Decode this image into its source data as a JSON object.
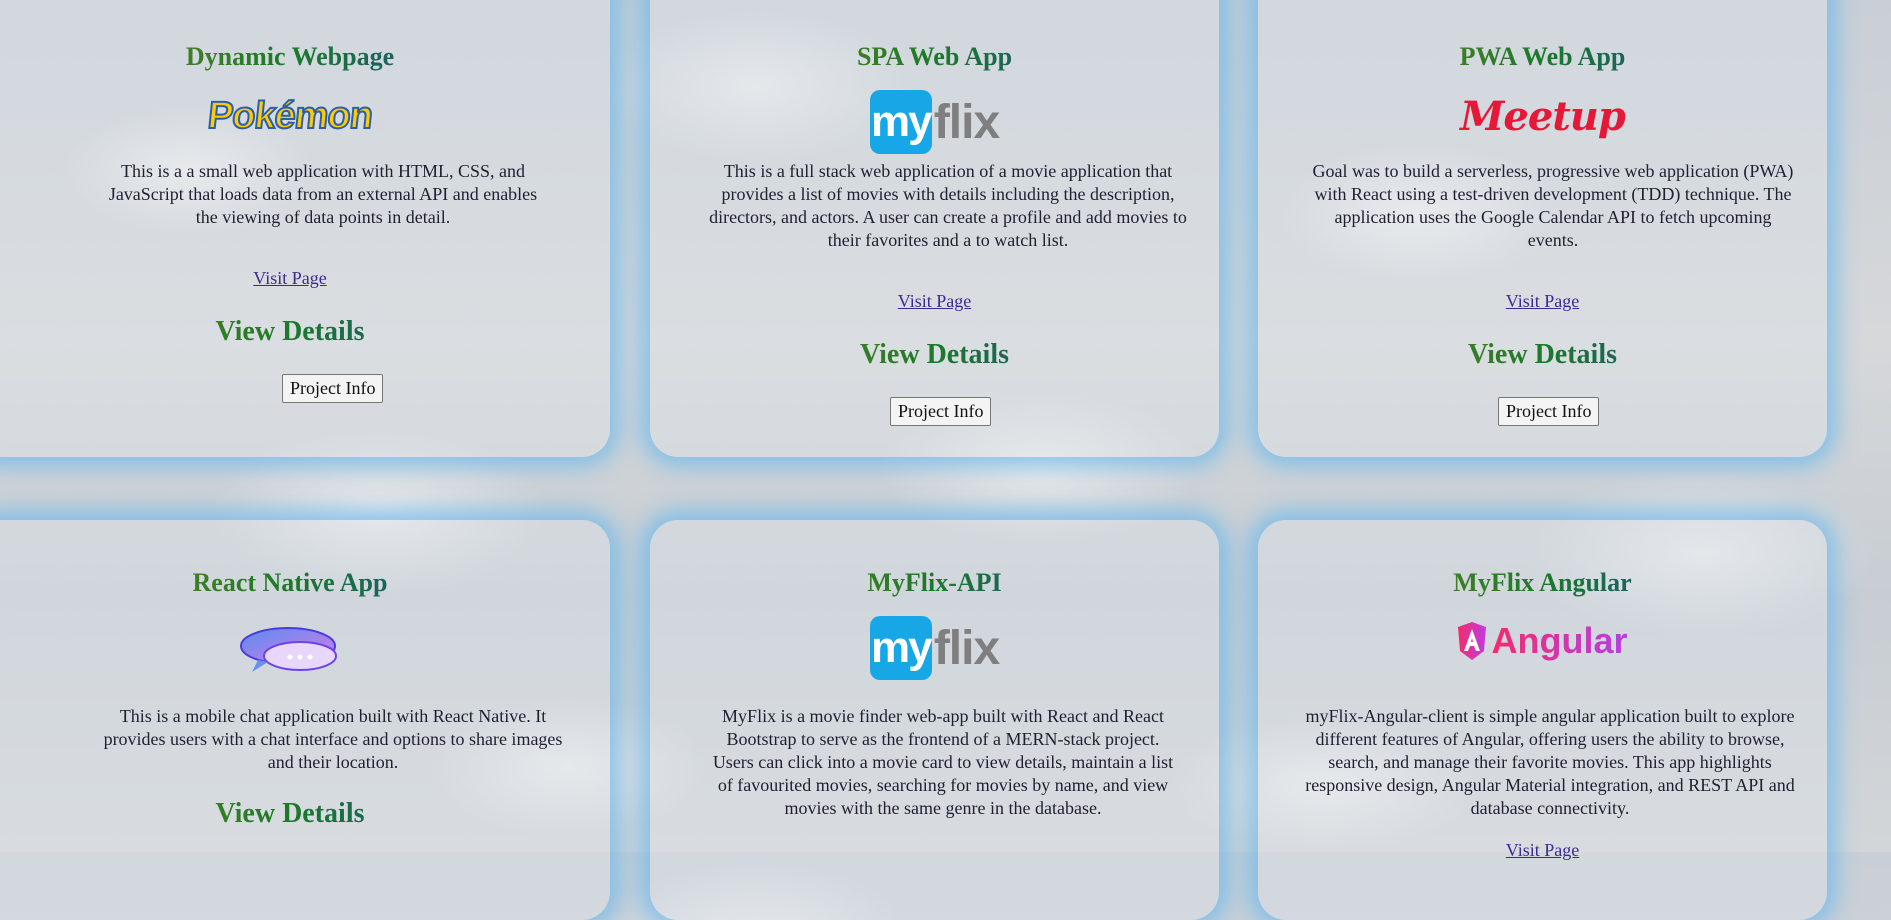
{
  "projects": [
    {
      "title_parts": [
        "Dynamic",
        "Webpage"
      ],
      "logo": "pokemon-logo",
      "logo_text": "Pokémon",
      "description": "This is a a small web application with HTML, CSS, and JavaScript that loads data from an external API and enables the viewing of data points in detail.",
      "link_label": "Visit Page",
      "details_heading": "View Details",
      "button_label": "Project Info"
    },
    {
      "title": "SPA Web App",
      "logo": "myflix-logo",
      "logo_text_my": "my",
      "logo_text_flix": "flix",
      "description": "This is a full stack web application of a movie application that provides a list of movies with details including the description, directors, and actors. A user can create a profile and add movies to their favorites and a to watch list.",
      "link_label": "Visit Page",
      "details_heading": "View Details",
      "button_label": "Project Info"
    },
    {
      "title": "PWA Web App",
      "logo": "meetup-logo",
      "logo_text": "Meetup",
      "description": "Goal was to build a serverless, progressive web application (PWA) with React using a test-driven development (TDD) technique. The application uses the Google Calendar API to fetch upcoming events.",
      "link_label": "Visit Page",
      "details_heading": "View Details",
      "button_label": "Project Info"
    },
    {
      "title": "React Native App",
      "logo": "chat-bubbles-logo",
      "description": "This is a mobile chat application built with React Native. It provides users with a chat interface and options to share images and their location.",
      "details_heading": "View Details"
    },
    {
      "title": "MyFlix-API",
      "logo": "myflix-logo",
      "logo_text_my": "my",
      "logo_text_flix": "flix",
      "description": "MyFlix is a movie finder web-app built with React and React Bootstrap to serve as the frontend of a MERN-stack project. Users can click into a movie card to view details, maintain a list of favourited movies, searching for movies by name, and view movies with the same genre in the database."
    },
    {
      "title": "MyFlix Angular",
      "logo": "angular-logo",
      "logo_text": "Angular",
      "description": "myFlix-Angular-client is simple angular application built to explore different features of Angular, offering users the ability to browse, search, and manage their favorite movies. This app highlights responsive design, Angular Material integration, and REST API and database connectivity.",
      "link_label": "Visit Page"
    }
  ],
  "colors": {
    "card_glow": "#6eb9eb",
    "title_gradient": [
      "#8a8a1e",
      "#1b7a28",
      "#1a2fd0"
    ],
    "link": "#3b2a8e"
  }
}
